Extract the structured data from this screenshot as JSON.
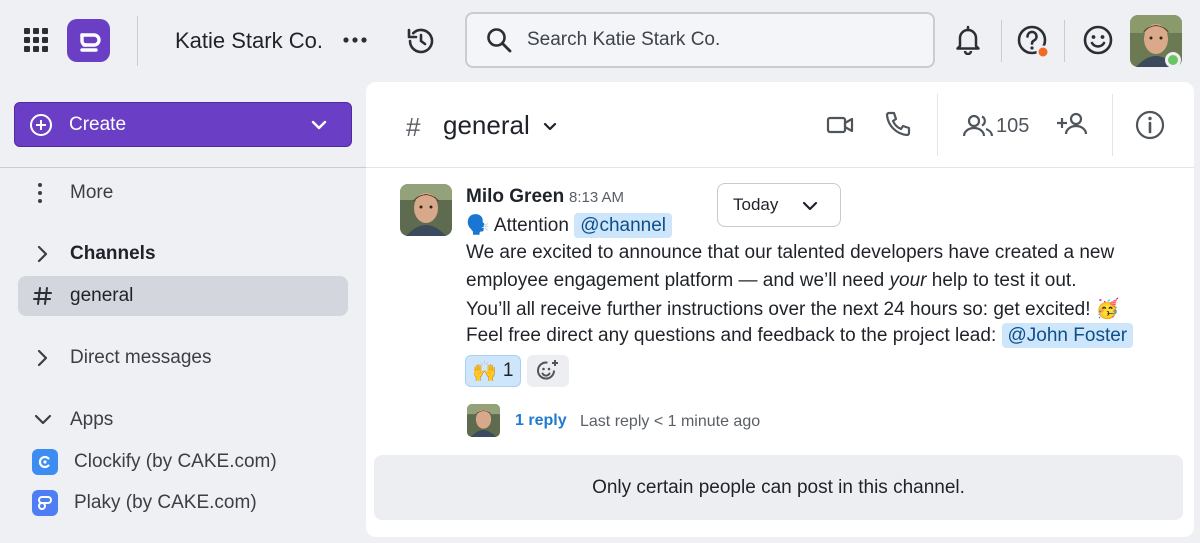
{
  "topbar": {
    "workspace_name": "Katie Stark Co.",
    "search_placeholder": "Search Katie Stark Co."
  },
  "sidebar": {
    "create_label": "Create",
    "more_label": "More",
    "channels_label": "Channels",
    "active_channel": "general",
    "direct_messages_label": "Direct messages",
    "apps_label": "Apps",
    "apps": [
      {
        "label": "Clockify (by CAKE.com)",
        "color": "#3d8cf2"
      },
      {
        "label": "Plaky (by CAKE.com)",
        "color": "#4f7df5"
      }
    ]
  },
  "channel": {
    "hash": "#",
    "name": "general",
    "member_count": "105"
  },
  "message": {
    "author": "Milo Green",
    "time": "8:13 AM",
    "date_label": "Today",
    "attention_emoji": "🗣️",
    "attention_text": "Attention",
    "channel_mention": "@channel",
    "line1": "We are excited to announce that our talented developers have created a new",
    "line2_a": "employee engagement platform — and we’ll need ",
    "line2_em": "your",
    "line2_b": " help to test it out.",
    "line3": "You’ll all receive further instructions over the next 24 hours so: get excited! ",
    "line3_emoji": "🥳",
    "line4": "Feel free direct any questions and feedback to the project lead: ",
    "user_mention": "@John Foster",
    "reaction_emoji": "🙌",
    "reaction_count": "1",
    "reply_link": "1 reply",
    "reply_meta": "Last reply < 1 minute ago"
  },
  "notice": "Only certain people can post in this channel.",
  "colors": {
    "brand_purple": "#6a3fc6",
    "mention_bg": "#cde6fb",
    "link_blue": "#1f7bd1",
    "online_green": "#6cc463",
    "alert_orange": "#f26a21"
  }
}
